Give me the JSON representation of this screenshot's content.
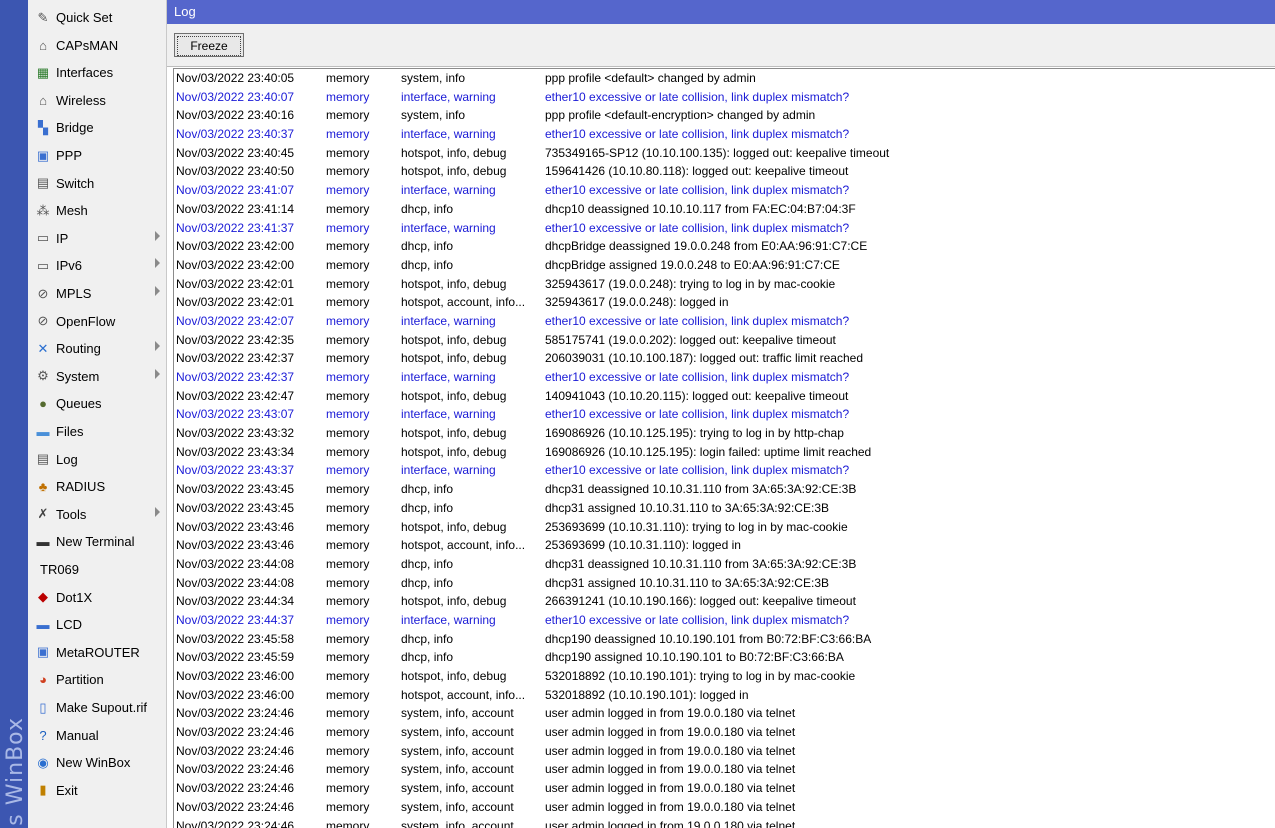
{
  "branding": {
    "vertical_text": "s WinBox"
  },
  "sidebar": {
    "items": [
      {
        "label": "Quick Set",
        "icon": "quick-set-icon",
        "submenu": false
      },
      {
        "label": "CAPsMAN",
        "icon": "capsman-icon",
        "submenu": false
      },
      {
        "label": "Interfaces",
        "icon": "interfaces-icon",
        "submenu": false
      },
      {
        "label": "Wireless",
        "icon": "wireless-icon",
        "submenu": false
      },
      {
        "label": "Bridge",
        "icon": "bridge-icon",
        "submenu": false
      },
      {
        "label": "PPP",
        "icon": "ppp-icon",
        "submenu": false
      },
      {
        "label": "Switch",
        "icon": "switch-icon",
        "submenu": false
      },
      {
        "label": "Mesh",
        "icon": "mesh-icon",
        "submenu": false
      },
      {
        "label": "IP",
        "icon": "ip-icon",
        "submenu": true
      },
      {
        "label": "IPv6",
        "icon": "ipv6-icon",
        "submenu": true
      },
      {
        "label": "MPLS",
        "icon": "mpls-icon",
        "submenu": true
      },
      {
        "label": "OpenFlow",
        "icon": "openflow-icon",
        "submenu": false
      },
      {
        "label": "Routing",
        "icon": "routing-icon",
        "submenu": true
      },
      {
        "label": "System",
        "icon": "system-icon",
        "submenu": true
      },
      {
        "label": "Queues",
        "icon": "queues-icon",
        "submenu": false
      },
      {
        "label": "Files",
        "icon": "files-icon",
        "submenu": false
      },
      {
        "label": "Log",
        "icon": "log-icon",
        "submenu": false
      },
      {
        "label": "RADIUS",
        "icon": "radius-icon",
        "submenu": false
      },
      {
        "label": "Tools",
        "icon": "tools-icon",
        "submenu": true
      },
      {
        "label": "New Terminal",
        "icon": "terminal-icon",
        "submenu": false
      },
      {
        "label": "TR069",
        "icon": "",
        "submenu": false
      },
      {
        "label": "Dot1X",
        "icon": "dot1x-icon",
        "submenu": false
      },
      {
        "label": "LCD",
        "icon": "lcd-icon",
        "submenu": false
      },
      {
        "label": "MetaROUTER",
        "icon": "metarouter-icon",
        "submenu": false
      },
      {
        "label": "Partition",
        "icon": "partition-icon",
        "submenu": false
      },
      {
        "label": "Make Supout.rif",
        "icon": "supout-icon",
        "submenu": false
      },
      {
        "label": "Manual",
        "icon": "manual-icon",
        "submenu": false
      },
      {
        "label": "New WinBox",
        "icon": "winbox-icon",
        "submenu": false
      },
      {
        "label": "Exit",
        "icon": "exit-icon",
        "submenu": false
      }
    ]
  },
  "window": {
    "title": "Log"
  },
  "toolbar": {
    "freeze_label": "Freeze"
  },
  "colors": {
    "title_bar": "#5566cc",
    "warning_text": "#1a1ad6",
    "info_text": "#000000",
    "brand_strip": "#3c56b1"
  },
  "log": {
    "entries": [
      {
        "time": "Nov/03/2022 23:40:05",
        "buffer": "memory",
        "topics": "system, info",
        "message": "ppp profile <default> changed by admin",
        "warning": false
      },
      {
        "time": "Nov/03/2022 23:40:07",
        "buffer": "memory",
        "topics": "interface, warning",
        "message": "ether10 excessive or late collision, link duplex mismatch?",
        "warning": true
      },
      {
        "time": "Nov/03/2022 23:40:16",
        "buffer": "memory",
        "topics": "system, info",
        "message": "ppp profile <default-encryption> changed by admin",
        "warning": false
      },
      {
        "time": "Nov/03/2022 23:40:37",
        "buffer": "memory",
        "topics": "interface, warning",
        "message": "ether10 excessive or late collision, link duplex mismatch?",
        "warning": true
      },
      {
        "time": "Nov/03/2022 23:40:45",
        "buffer": "memory",
        "topics": "hotspot, info, debug",
        "message": "735349165-SP12 (10.10.100.135): logged out: keepalive timeout",
        "warning": false
      },
      {
        "time": "Nov/03/2022 23:40:50",
        "buffer": "memory",
        "topics": "hotspot, info, debug",
        "message": "159641426 (10.10.80.118): logged out: keepalive timeout",
        "warning": false
      },
      {
        "time": "Nov/03/2022 23:41:07",
        "buffer": "memory",
        "topics": "interface, warning",
        "message": "ether10 excessive or late collision, link duplex mismatch?",
        "warning": true
      },
      {
        "time": "Nov/03/2022 23:41:14",
        "buffer": "memory",
        "topics": "dhcp, info",
        "message": "dhcp10 deassigned 10.10.10.117 from FA:EC:04:B7:04:3F",
        "warning": false
      },
      {
        "time": "Nov/03/2022 23:41:37",
        "buffer": "memory",
        "topics": "interface, warning",
        "message": "ether10 excessive or late collision, link duplex mismatch?",
        "warning": true
      },
      {
        "time": "Nov/03/2022 23:42:00",
        "buffer": "memory",
        "topics": "dhcp, info",
        "message": "dhcpBridge deassigned 19.0.0.248 from E0:AA:96:91:C7:CE",
        "warning": false
      },
      {
        "time": "Nov/03/2022 23:42:00",
        "buffer": "memory",
        "topics": "dhcp, info",
        "message": "dhcpBridge assigned 19.0.0.248 to E0:AA:96:91:C7:CE",
        "warning": false
      },
      {
        "time": "Nov/03/2022 23:42:01",
        "buffer": "memory",
        "topics": "hotspot, info, debug",
        "message": "325943617 (19.0.0.248): trying to log in by mac-cookie",
        "warning": false
      },
      {
        "time": "Nov/03/2022 23:42:01",
        "buffer": "memory",
        "topics": "hotspot, account, info...",
        "message": "325943617 (19.0.0.248): logged in",
        "warning": false
      },
      {
        "time": "Nov/03/2022 23:42:07",
        "buffer": "memory",
        "topics": "interface, warning",
        "message": "ether10 excessive or late collision, link duplex mismatch?",
        "warning": true
      },
      {
        "time": "Nov/03/2022 23:42:35",
        "buffer": "memory",
        "topics": "hotspot, info, debug",
        "message": "585175741 (19.0.0.202): logged out: keepalive timeout",
        "warning": false
      },
      {
        "time": "Nov/03/2022 23:42:37",
        "buffer": "memory",
        "topics": "hotspot, info, debug",
        "message": "206039031 (10.10.100.187): logged out: traffic limit reached",
        "warning": false
      },
      {
        "time": "Nov/03/2022 23:42:37",
        "buffer": "memory",
        "topics": "interface, warning",
        "message": "ether10 excessive or late collision, link duplex mismatch?",
        "warning": true
      },
      {
        "time": "Nov/03/2022 23:42:47",
        "buffer": "memory",
        "topics": "hotspot, info, debug",
        "message": "140941043 (10.10.20.115): logged out: keepalive timeout",
        "warning": false
      },
      {
        "time": "Nov/03/2022 23:43:07",
        "buffer": "memory",
        "topics": "interface, warning",
        "message": "ether10 excessive or late collision, link duplex mismatch?",
        "warning": true
      },
      {
        "time": "Nov/03/2022 23:43:32",
        "buffer": "memory",
        "topics": "hotspot, info, debug",
        "message": "169086926 (10.10.125.195): trying to log in by http-chap",
        "warning": false
      },
      {
        "time": "Nov/03/2022 23:43:34",
        "buffer": "memory",
        "topics": "hotspot, info, debug",
        "message": "169086926 (10.10.125.195): login failed: uptime limit reached",
        "warning": false
      },
      {
        "time": "Nov/03/2022 23:43:37",
        "buffer": "memory",
        "topics": "interface, warning",
        "message": "ether10 excessive or late collision, link duplex mismatch?",
        "warning": true
      },
      {
        "time": "Nov/03/2022 23:43:45",
        "buffer": "memory",
        "topics": "dhcp, info",
        "message": "dhcp31 deassigned 10.10.31.110 from 3A:65:3A:92:CE:3B",
        "warning": false
      },
      {
        "time": "Nov/03/2022 23:43:45",
        "buffer": "memory",
        "topics": "dhcp, info",
        "message": "dhcp31 assigned 10.10.31.110 to 3A:65:3A:92:CE:3B",
        "warning": false
      },
      {
        "time": "Nov/03/2022 23:43:46",
        "buffer": "memory",
        "topics": "hotspot, info, debug",
        "message": "253693699 (10.10.31.110): trying to log in by mac-cookie",
        "warning": false
      },
      {
        "time": "Nov/03/2022 23:43:46",
        "buffer": "memory",
        "topics": "hotspot, account, info...",
        "message": "253693699 (10.10.31.110): logged in",
        "warning": false
      },
      {
        "time": "Nov/03/2022 23:44:08",
        "buffer": "memory",
        "topics": "dhcp, info",
        "message": "dhcp31 deassigned 10.10.31.110 from 3A:65:3A:92:CE:3B",
        "warning": false
      },
      {
        "time": "Nov/03/2022 23:44:08",
        "buffer": "memory",
        "topics": "dhcp, info",
        "message": "dhcp31 assigned 10.10.31.110 to 3A:65:3A:92:CE:3B",
        "warning": false
      },
      {
        "time": "Nov/03/2022 23:44:34",
        "buffer": "memory",
        "topics": "hotspot, info, debug",
        "message": "266391241 (10.10.190.166): logged out: keepalive timeout",
        "warning": false
      },
      {
        "time": "Nov/03/2022 23:44:37",
        "buffer": "memory",
        "topics": "interface, warning",
        "message": "ether10 excessive or late collision, link duplex mismatch?",
        "warning": true
      },
      {
        "time": "Nov/03/2022 23:45:58",
        "buffer": "memory",
        "topics": "dhcp, info",
        "message": "dhcp190 deassigned 10.10.190.101 from B0:72:BF:C3:66:BA",
        "warning": false
      },
      {
        "time": "Nov/03/2022 23:45:59",
        "buffer": "memory",
        "topics": "dhcp, info",
        "message": "dhcp190 assigned 10.10.190.101 to B0:72:BF:C3:66:BA",
        "warning": false
      },
      {
        "time": "Nov/03/2022 23:46:00",
        "buffer": "memory",
        "topics": "hotspot, info, debug",
        "message": "532018892 (10.10.190.101): trying to log in by mac-cookie",
        "warning": false
      },
      {
        "time": "Nov/03/2022 23:46:00",
        "buffer": "memory",
        "topics": "hotspot, account, info...",
        "message": "532018892 (10.10.190.101): logged in",
        "warning": false
      },
      {
        "time": "Nov/03/2022 23:24:46",
        "buffer": "memory",
        "topics": "system, info, account",
        "message": "user admin logged in from 19.0.0.180 via telnet",
        "warning": false
      },
      {
        "time": "Nov/03/2022 23:24:46",
        "buffer": "memory",
        "topics": "system, info, account",
        "message": "user admin logged in from 19.0.0.180 via telnet",
        "warning": false
      },
      {
        "time": "Nov/03/2022 23:24:46",
        "buffer": "memory",
        "topics": "system, info, account",
        "message": "user admin logged in from 19.0.0.180 via telnet",
        "warning": false
      },
      {
        "time": "Nov/03/2022 23:24:46",
        "buffer": "memory",
        "topics": "system, info, account",
        "message": "user admin logged in from 19.0.0.180 via telnet",
        "warning": false
      },
      {
        "time": "Nov/03/2022 23:24:46",
        "buffer": "memory",
        "topics": "system, info, account",
        "message": "user admin logged in from 19.0.0.180 via telnet",
        "warning": false
      },
      {
        "time": "Nov/03/2022 23:24:46",
        "buffer": "memory",
        "topics": "system, info, account",
        "message": "user admin logged in from 19.0.0.180 via telnet",
        "warning": false
      },
      {
        "time": "Nov/03/2022 23:24:46",
        "buffer": "memory",
        "topics": "system, info, account",
        "message": "user admin logged in from 19.0.0.180 via telnet",
        "warning": false
      }
    ]
  }
}
